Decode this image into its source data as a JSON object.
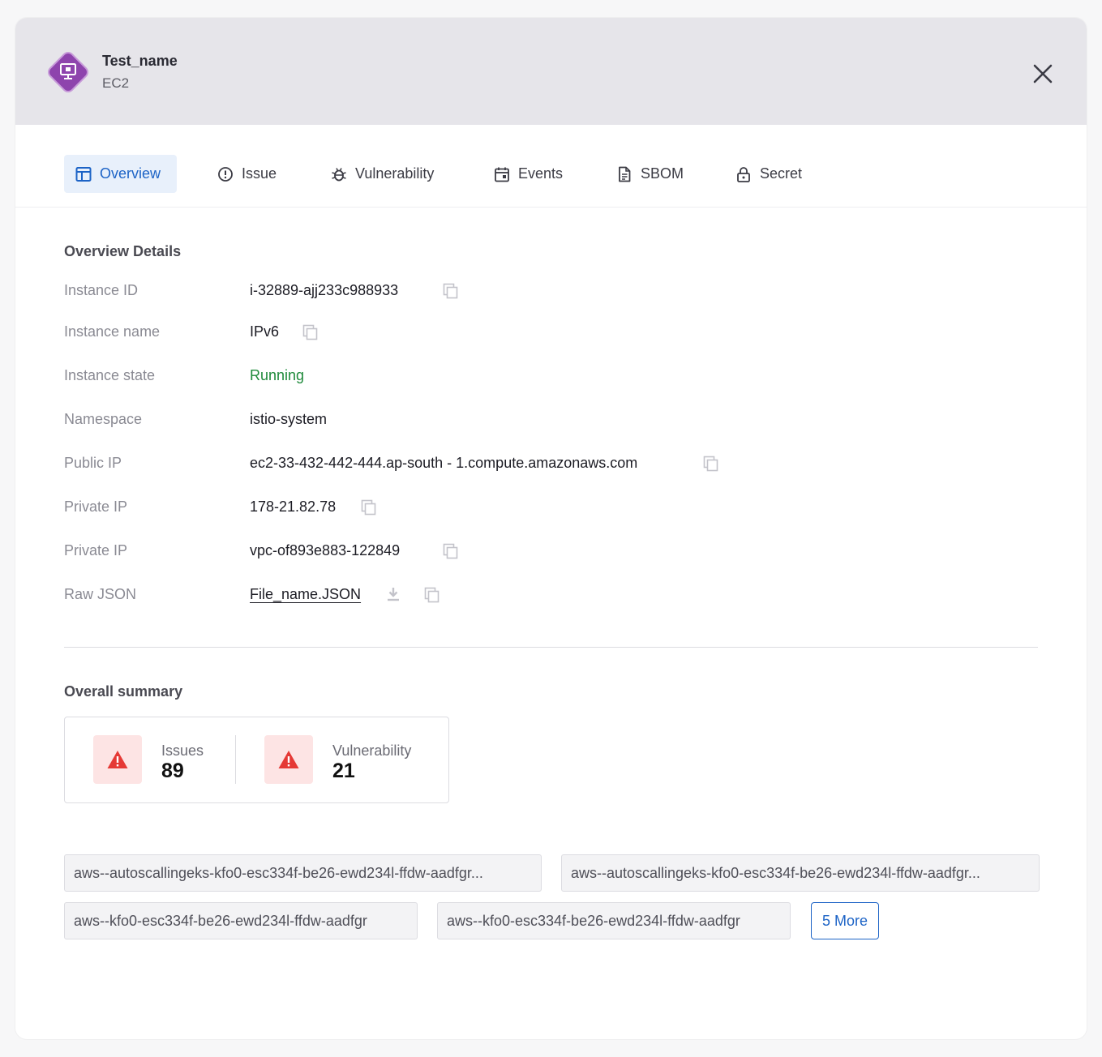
{
  "header": {
    "title": "Test_name",
    "subtitle": "EC2",
    "icon": "monitor-icon",
    "icon_color": "#8e44ad"
  },
  "tabs": [
    {
      "label": "Overview",
      "icon": "layout-icon",
      "active": true
    },
    {
      "label": "Issue",
      "icon": "alert-circle-icon",
      "active": false
    },
    {
      "label": "Vulnerability",
      "icon": "bug-icon",
      "active": false
    },
    {
      "label": "Events",
      "icon": "calendar-icon",
      "active": false
    },
    {
      "label": "SBOM",
      "icon": "document-icon",
      "active": false
    },
    {
      "label": "Secret",
      "icon": "lock-icon",
      "active": false
    }
  ],
  "overview": {
    "title": "Overview Details",
    "rows": [
      {
        "label": "Instance ID",
        "value": "i-32889-ajj233c988933"
      },
      {
        "label": "Instance name",
        "value": "IPv6"
      },
      {
        "label": "Instance state",
        "value": "Running"
      },
      {
        "label": "Namespace",
        "value": "istio-system"
      },
      {
        "label": "Public IP",
        "value": "ec2-33-432-442-444.ap-south - 1.compute.amazonaws.com"
      },
      {
        "label": "Private IP",
        "value": "178-21.82.78"
      },
      {
        "label": "Private IP",
        "value": "vpc-of893e883-122849"
      },
      {
        "label": "Raw JSON",
        "value": "File_name.JSON"
      }
    ]
  },
  "summary": {
    "title": "Overall summary",
    "issues_label": "Issues",
    "issues_value": "89",
    "vuln_label": "Vulnerability",
    "vuln_value": "21",
    "warn_color": "#e53935"
  },
  "tags": {
    "items": [
      "aws--autoscallingeks-kfo0-esc334f-be26-ewd234l-ffdw-aadfgr...",
      "aws--autoscallingeks-kfo0-esc334f-be26-ewd234l-ffdw-aadfgr...",
      "aws--kfo0-esc334f-be26-ewd234l-ffdw-aadfgr",
      "aws--kfo0-esc334f-be26-ewd234l-ffdw-aadfgr"
    ],
    "more_label": "5 More"
  }
}
